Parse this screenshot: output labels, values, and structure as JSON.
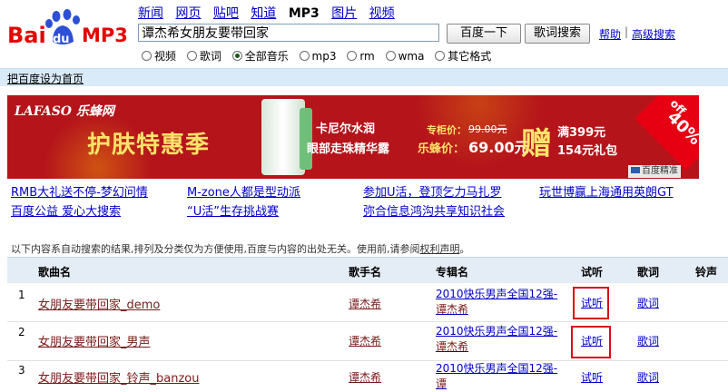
{
  "logo": {
    "text_bai": "Bai",
    "text_du": "du",
    "text_mp3": "MP3"
  },
  "nav": [
    {
      "label": "新闻",
      "current": false
    },
    {
      "label": "网页",
      "current": false
    },
    {
      "label": "贴吧",
      "current": false
    },
    {
      "label": "知道",
      "current": false
    },
    {
      "label": "MP3",
      "current": true
    },
    {
      "label": "图片",
      "current": false
    },
    {
      "label": "视频",
      "current": false
    }
  ],
  "search": {
    "value": "谭杰希女朋友要带回家",
    "btn_search": "百度一下",
    "btn_lyric": "歌词搜索",
    "help": "帮助",
    "sep": "|",
    "advanced": "高级搜索"
  },
  "filters": {
    "selected": "全部音乐",
    "options": [
      "视频",
      "歌词",
      "全部音乐",
      "mp3",
      "rm",
      "wma",
      "其它格式"
    ]
  },
  "sethome": "把百度设为首页",
  "banner": {
    "logo": "LAFASO 乐蜂网",
    "title": "护肤特惠季",
    "product_l1": "卡尼尔水润",
    "product_l2": "眼部走珠精华露",
    "price_label": "专柜价：",
    "price_old": "99.00元",
    "price2_label": "乐蜂价：",
    "price_new": "69.00元",
    "gift_char": "赠",
    "gift_l1": "满399元",
    "gift_l2": "154元礼包",
    "off_word": "off",
    "off_pct": "40%",
    "tag": "百度精准"
  },
  "promo_links": [
    [
      "RMB大礼送不停-梦幻问情",
      "M-zone人都是型动派",
      "参加U活，登顶乞力马扎罗",
      "玩世博赢上海通用英朗GT"
    ],
    [
      "百度公益 爱心大搜索",
      "“U活”生存挑战赛",
      "弥合信息鸿沟共享知识社会"
    ]
  ],
  "notice": {
    "text": "以下内容系自动搜索的结果,排列及分类仅为方便使用,百度与内容的出处无关。使用前,请参阅",
    "link": "权利声明",
    "end": "。"
  },
  "table": {
    "headers": [
      "歌曲名",
      "歌手名",
      "专辑名",
      "试听",
      "歌词",
      "铃声"
    ],
    "rows": [
      {
        "num": "1",
        "song": "女朋友要带回家_demo",
        "singer": "谭杰希",
        "album_a": "2010快乐男声全国12强-",
        "album_hl": "谭",
        "album_b": "杰希",
        "listen": "试听",
        "lyric": "歌词"
      },
      {
        "num": "2",
        "song": "女朋友要带回家_男声",
        "singer": "谭杰希",
        "album_a": "2010快乐男声全国12强-",
        "album_hl": "谭",
        "album_b": "杰希",
        "listen": "试听",
        "lyric": "歌词"
      },
      {
        "num": "3",
        "song": "女朋友要带回家_铃声_banzou",
        "singer": "谭杰希",
        "album_a": "2010快乐男声全国12强-",
        "album_hl": "谭",
        "album_b": "",
        "listen": "试听",
        "lyric": "歌词"
      }
    ]
  },
  "colors": {
    "banner_bg": "#b5141b",
    "link": "#0000cc",
    "song": "#7a1a1a",
    "highlight_box": "#d80c18",
    "header_bar": "#d9eaf8"
  }
}
